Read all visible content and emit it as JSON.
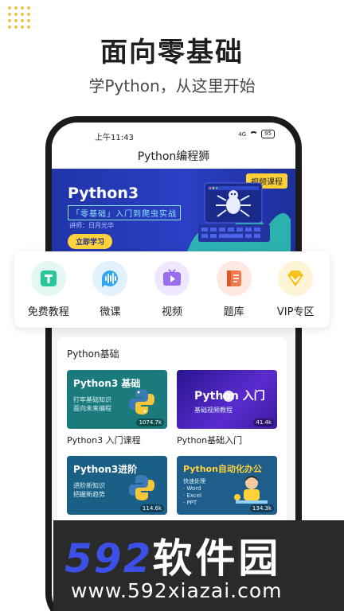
{
  "hero": {
    "headline": "面向零基础",
    "subline": "学Python，从这里开始"
  },
  "status_bar": {
    "time": "上午11:43",
    "signal": "4G",
    "battery": "95"
  },
  "app": {
    "title": "Python编程狮"
  },
  "banner": {
    "tag": "视频课程",
    "title": "Python3",
    "slogan": "「零基础」入门到爬虫实战",
    "lecturer": "讲师：日月光华",
    "cta": "立即学习"
  },
  "quick_nav": [
    {
      "label": "免费教程",
      "icon": "book-icon",
      "color": "#27c79a",
      "bg": "#e3f8f1"
    },
    {
      "label": "微课",
      "icon": "audio-wave-icon",
      "color": "#2fa6f2",
      "bg": "#e1f2fd"
    },
    {
      "label": "视频",
      "icon": "tv-play-icon",
      "color": "#9b6cf0",
      "bg": "#efe7fd"
    },
    {
      "label": "题库",
      "icon": "question-bank-icon",
      "color": "#f07a4b",
      "bg": "#fde9e1"
    },
    {
      "label": "VIP专区",
      "icon": "vip-diamond-icon",
      "color": "#f7c21c",
      "bg": "#fff5d6"
    }
  ],
  "section": {
    "title": "Python基础",
    "courses": [
      {
        "thumb_title": "Python3 基础",
        "thumb_sub": [
          "打牢基础知识",
          "面向未来编程"
        ],
        "views": "1074.7k",
        "caption": "Python3 入门课程",
        "bg": "#1a7a7c"
      },
      {
        "thumb_title": "Python 入门",
        "thumb_sub": [
          "基础视频教程"
        ],
        "views": "41.4k",
        "caption": "Python基础入门",
        "bg": "#3a1ea0"
      },
      {
        "thumb_title": "Python3进阶",
        "thumb_sub": [
          "进阶新知识",
          "把握新趋势"
        ],
        "views": "114.6k",
        "caption": "",
        "bg": "#1a5f86"
      },
      {
        "thumb_title": "Python自动化办公",
        "thumb_sub": [
          "快速处理",
          "· Word",
          "· Excel",
          "· PPT"
        ],
        "views": "134.3k",
        "caption": "",
        "bg": "#1f5e8a"
      }
    ]
  },
  "watermark": {
    "brand_num": "592",
    "brand_cn": "软件园",
    "url": "www.592xiazai.com"
  }
}
